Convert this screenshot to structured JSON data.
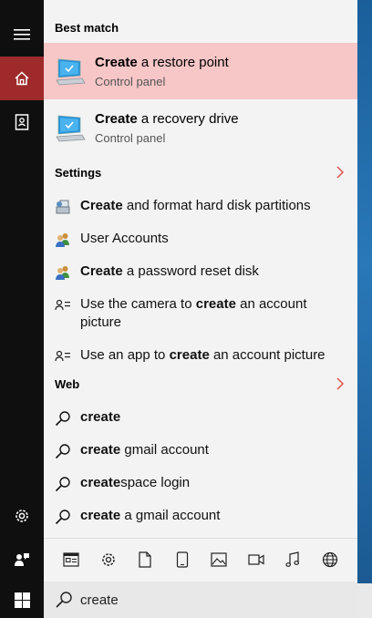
{
  "sections": {
    "best_match": "Best match",
    "settings": "Settings",
    "web": "Web"
  },
  "best_match": [
    {
      "bold": "Create",
      "rest": " a restore point",
      "subtitle": "Control panel",
      "highlighted": true
    },
    {
      "bold": "Create",
      "rest": " a recovery drive",
      "subtitle": "Control panel",
      "highlighted": false
    }
  ],
  "settings_items": [
    {
      "icon": "disk-management-icon",
      "bold": "Create",
      "rest": " and format hard disk partitions"
    },
    {
      "icon": "user-accounts-icon",
      "bold": "",
      "rest": "User Accounts"
    },
    {
      "icon": "user-accounts-icon",
      "bold": "Create",
      "rest": " a password reset disk"
    },
    {
      "icon": "account-picture-icon",
      "pre": "Use the camera to ",
      "bold": "create",
      "rest": " an account picture"
    },
    {
      "icon": "account-picture-icon",
      "pre": "Use an app to ",
      "bold": "create",
      "rest": " an account picture"
    }
  ],
  "web_items": [
    {
      "bold": "create",
      "rest": ""
    },
    {
      "bold": "create",
      "rest": " gmail account"
    },
    {
      "bold": "create",
      "rest": "space login"
    },
    {
      "bold": "create",
      "rest": " a gmail account"
    }
  ],
  "filters": [
    "apps-filter-icon",
    "settings-filter-icon",
    "documents-filter-icon",
    "folders-filter-icon",
    "photos-filter-icon",
    "videos-filter-icon",
    "music-filter-icon",
    "web-filter-icon"
  ],
  "search": {
    "value": "create"
  },
  "colors": {
    "accent": "#9e2a2b",
    "highlight": "#f7c6c7",
    "chevron": "#e05050"
  }
}
